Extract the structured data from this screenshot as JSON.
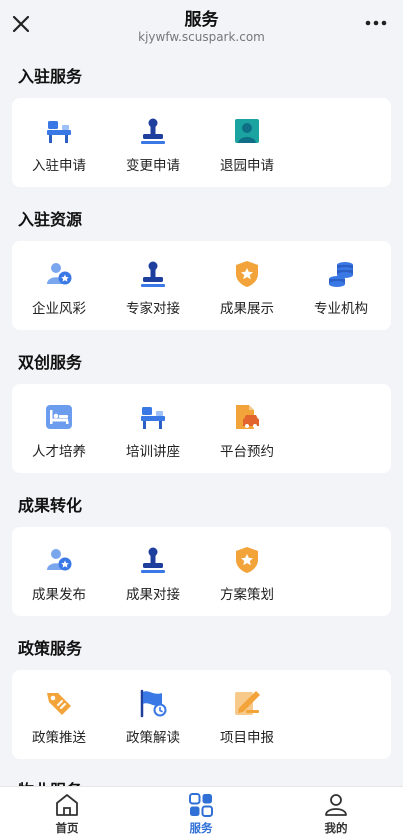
{
  "header": {
    "title": "服务",
    "url": "kjywfw.scuspark.com"
  },
  "sections": [
    {
      "title": "入驻服务",
      "items": [
        {
          "label": "入驻申请",
          "icon": "desk-icon"
        },
        {
          "label": "变更申请",
          "icon": "stamp-icon"
        },
        {
          "label": "退园申请",
          "icon": "person-portrait-icon"
        }
      ]
    },
    {
      "title": "入驻资源",
      "items": [
        {
          "label": "企业风彩",
          "icon": "person-badge-icon"
        },
        {
          "label": "专家对接",
          "icon": "stamp-icon"
        },
        {
          "label": "成果展示",
          "icon": "shield-star-icon"
        },
        {
          "label": "专业机构",
          "icon": "coin-stack-icon"
        }
      ]
    },
    {
      "title": "双创服务",
      "items": [
        {
          "label": "人才培养",
          "icon": "bed-icon"
        },
        {
          "label": "培训讲座",
          "icon": "desk-icon"
        },
        {
          "label": "平台预约",
          "icon": "car-document-icon"
        }
      ]
    },
    {
      "title": "成果转化",
      "items": [
        {
          "label": "成果发布",
          "icon": "person-badge-icon"
        },
        {
          "label": "成果对接",
          "icon": "stamp-icon"
        },
        {
          "label": "方案策划",
          "icon": "shield-star-icon"
        }
      ]
    },
    {
      "title": "政策服务",
      "items": [
        {
          "label": "政策推送",
          "icon": "tag-icon"
        },
        {
          "label": "政策解读",
          "icon": "flag-icon"
        },
        {
          "label": "项目申报",
          "icon": "pencil-document-icon"
        }
      ]
    },
    {
      "title": "物业服务",
      "items": []
    }
  ],
  "tabs": [
    {
      "label": "首页",
      "icon": "home-icon",
      "active": false
    },
    {
      "label": "服务",
      "icon": "grid-icon",
      "active": true
    },
    {
      "label": "我的",
      "icon": "user-icon",
      "active": false
    }
  ],
  "colors": {
    "accent": "#2f6fd6",
    "icon_blue": "#3a78e6",
    "icon_dark_blue": "#1f3f9e",
    "icon_orange": "#f2a33a",
    "icon_teal": "#1aa3a0"
  }
}
